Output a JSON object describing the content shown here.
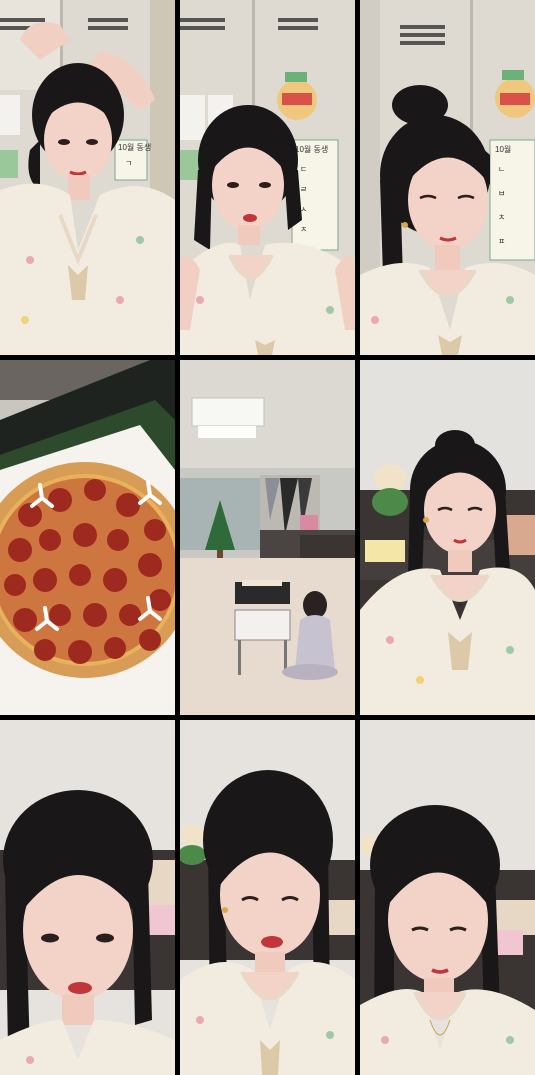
{
  "frames": [
    {
      "id": 1,
      "scene": "selfie-tying-hair",
      "sign": "10월 동생",
      "chart_letters": [
        "ㄱ"
      ]
    },
    {
      "id": 2,
      "scene": "selfie-smiling",
      "sign": "10월 동생",
      "chart_letters": [
        "ㄷ",
        "ㄹ",
        "ㅅ",
        "ㅈ"
      ]
    },
    {
      "id": 3,
      "scene": "selfie-looking-down",
      "sign": "10월",
      "chart_letters": [
        "ㄴ",
        "ㅂ",
        "ㅊ",
        "ㅍ"
      ]
    },
    {
      "id": 4,
      "scene": "pepperoni-pizza"
    },
    {
      "id": 5,
      "scene": "living-room-child"
    },
    {
      "id": 6,
      "scene": "selfie-on-sofa"
    },
    {
      "id": 7,
      "scene": "close-up-selfie"
    },
    {
      "id": 8,
      "scene": "close-up-selfie-talking"
    },
    {
      "id": 9,
      "scene": "selfie-looking-down-sofa"
    }
  ],
  "colors": {
    "hair": "#1a1718",
    "skin": "#f3d3c8",
    "pajama": "#f2ece0",
    "wall": "#ddd9d2",
    "sofa": "#3a3533",
    "pizza_sauce": "#b8452a",
    "pepperoni": "#9e2a1f",
    "crust": "#d79c55"
  }
}
